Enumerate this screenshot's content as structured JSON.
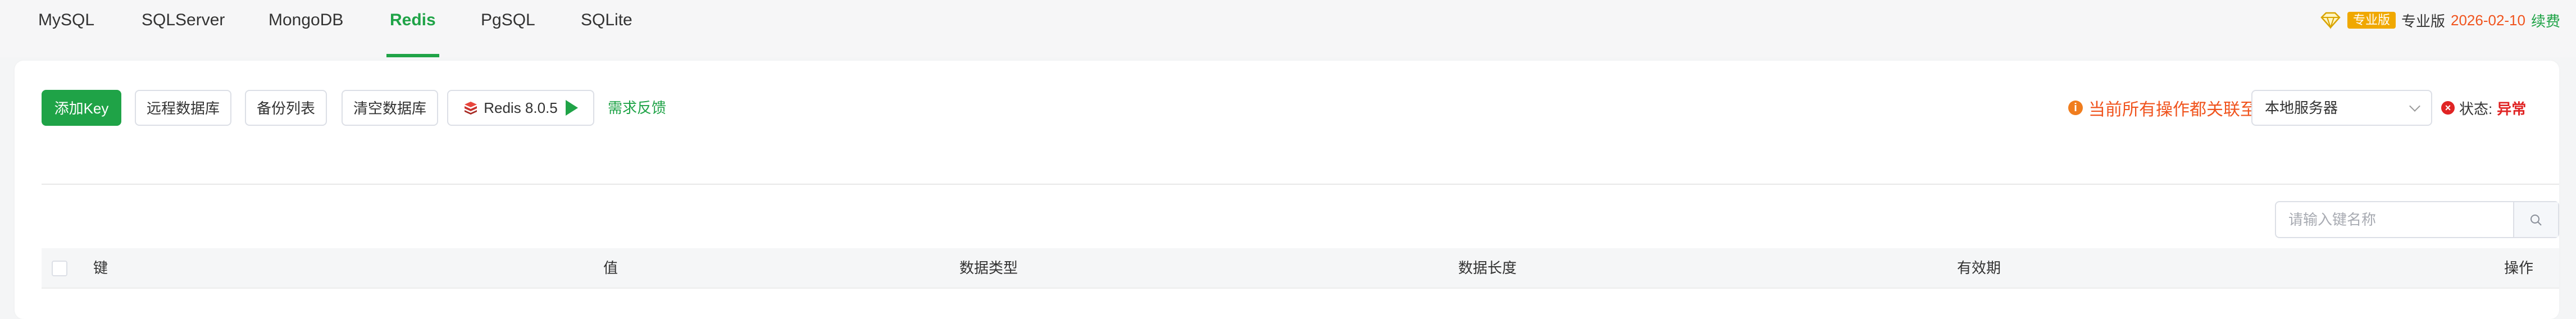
{
  "tabs": [
    {
      "label": "MySQL",
      "active": false
    },
    {
      "label": "SQLServer",
      "active": false
    },
    {
      "label": "MongoDB",
      "active": false
    },
    {
      "label": "Redis",
      "active": true
    },
    {
      "label": "PgSQL",
      "active": false
    },
    {
      "label": "SQLite",
      "active": false
    }
  ],
  "pro": {
    "badge": "专业版",
    "label": "专业版",
    "date": "2026-02-10",
    "renew": "续费",
    "icon": "crown-icon"
  },
  "toolbar": {
    "add_key": "添加Key",
    "remote_db": "远程数据库",
    "backup_list": "备份列表",
    "clear_db": "清空数据库",
    "redis_version": "Redis 8.0.5",
    "feedback": "需求反馈"
  },
  "notice": {
    "text": "当前所有操作都关联至",
    "icon": "info-icon"
  },
  "server_select": {
    "value": "本地服务器"
  },
  "status": {
    "label": "状态:",
    "value": "异常",
    "icon": "error-icon"
  },
  "search": {
    "placeholder": "请输入键名称"
  },
  "table": {
    "columns": [
      "键",
      "值",
      "数据类型",
      "数据长度",
      "有效期",
      "操作"
    ]
  },
  "colors": {
    "accent": "#1fa347",
    "warning": "#f0541e",
    "error": "#e02424",
    "pro_badge": "#f0a800"
  }
}
